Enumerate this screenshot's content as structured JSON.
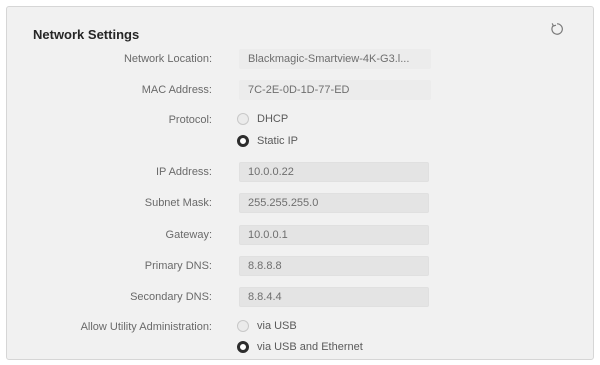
{
  "panel": {
    "title": "Network Settings",
    "reset_icon": "reset-icon"
  },
  "network_location": {
    "label": "Network Location:",
    "value": "Blackmagic-Smartview-4K-G3.l..."
  },
  "mac_address": {
    "label": "MAC Address:",
    "value": "7C-2E-0D-1D-77-ED"
  },
  "protocol": {
    "label": "Protocol:",
    "options": [
      {
        "label": "DHCP",
        "selected": false
      },
      {
        "label": "Static IP",
        "selected": true
      }
    ]
  },
  "ip_address": {
    "label": "IP Address:",
    "value": "10.0.0.22"
  },
  "subnet_mask": {
    "label": "Subnet Mask:",
    "value": "255.255.255.0"
  },
  "gateway": {
    "label": "Gateway:",
    "value": "10.0.0.1"
  },
  "primary_dns": {
    "label": "Primary DNS:",
    "value": "8.8.8.8"
  },
  "secondary_dns": {
    "label": "Secondary DNS:",
    "value": "8.8.4.4"
  },
  "utility_admin": {
    "label": "Allow Utility Administration:",
    "options": [
      {
        "label": "via USB",
        "selected": false
      },
      {
        "label": "via USB and Ethernet",
        "selected": true
      }
    ]
  }
}
